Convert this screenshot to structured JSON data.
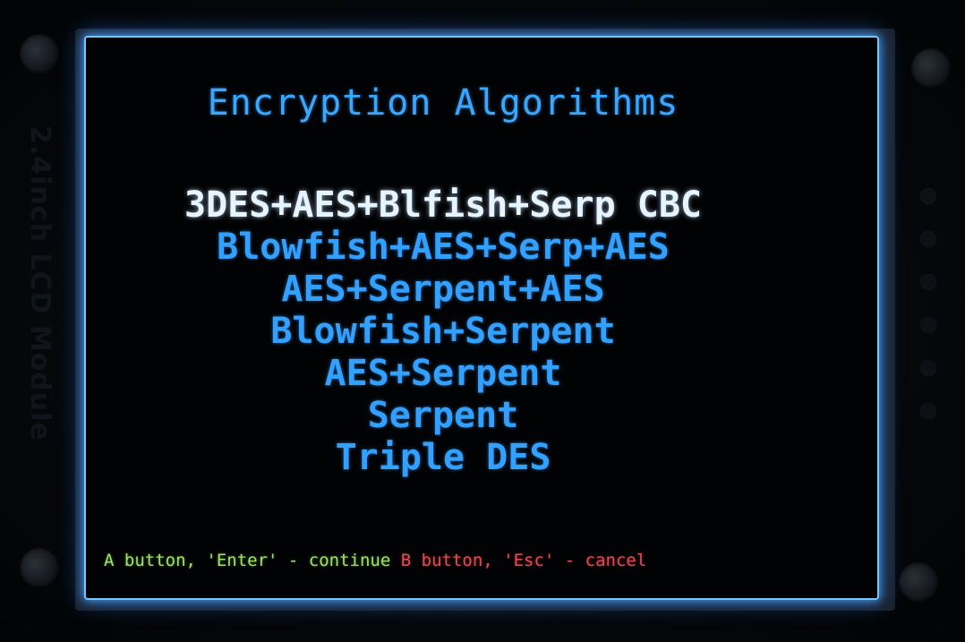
{
  "module_label": "2.4inch LCD Module",
  "screen": {
    "title": "Encryption Algorithms",
    "algorithms": [
      {
        "label": "3DES+AES+Blfish+Serp CBC",
        "selected": true
      },
      {
        "label": "Blowfish+AES+Serp+AES",
        "selected": false
      },
      {
        "label": "AES+Serpent+AES",
        "selected": false
      },
      {
        "label": "Blowfish+Serpent",
        "selected": false
      },
      {
        "label": "AES+Serpent",
        "selected": false
      },
      {
        "label": "Serpent",
        "selected": false
      },
      {
        "label": "Triple DES",
        "selected": false
      }
    ],
    "footer": {
      "continue_hint": "A button, 'Enter' - continue",
      "cancel_hint": "B button, 'Esc' - cancel"
    }
  },
  "colors": {
    "title": "#3aa7ff",
    "item": "#32a0ff",
    "selected_item": "#e6f4ff",
    "continue_hint": "#9ee06a",
    "cancel_hint": "#e04a52",
    "backlight_glow": "#6fc8ff"
  }
}
